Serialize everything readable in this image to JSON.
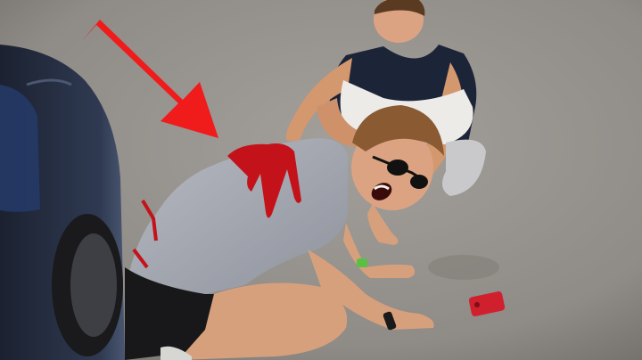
{
  "image": {
    "kind": "photo-thumbnail",
    "has_visible_text": false
  },
  "colors": {
    "asphalt": "#8f8b86",
    "asphalt_dark": "#6f6b67",
    "arrow_red": "#f01b1b",
    "blood_red": "#c4121a",
    "shirt_grey": "#a6a9b1",
    "shirt_navy": "#1c2438",
    "shorts_white": "#ecebe8",
    "skin": "#d9a07f",
    "hair": "#8a5a32",
    "car_body": "#2a3346",
    "phone_red": "#d0202e"
  },
  "icons": [
    "arrow-down-right-icon",
    "smartphone-icon"
  ]
}
